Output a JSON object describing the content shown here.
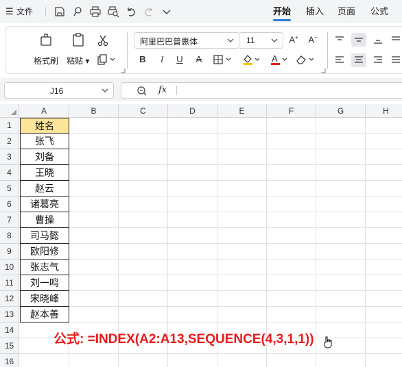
{
  "menu": {
    "file_label": "文件",
    "tabs": [
      "开始",
      "插入",
      "页面",
      "公式"
    ],
    "active_tab": "开始"
  },
  "ribbon": {
    "format_painter": "格式刷",
    "paste": "粘贴",
    "font_name": "阿里巴巴普惠体",
    "font_size": "11"
  },
  "formula_bar": {
    "name_box": "J16",
    "fx": "fx",
    "content": ""
  },
  "sheet": {
    "columns": [
      "A",
      "B",
      "C",
      "D",
      "E",
      "F",
      "G",
      "H"
    ],
    "rows": [
      "1",
      "2",
      "3",
      "4",
      "5",
      "6",
      "7",
      "8",
      "9",
      "10",
      "11",
      "12",
      "13",
      "14",
      "15",
      "16"
    ],
    "header_cell": "姓名",
    "names": [
      "张飞",
      "刘备",
      "王晓",
      "赵云",
      "诸葛亮",
      "曹操",
      "司马懿",
      "欧阳修",
      "张志气",
      "刘一鸣",
      "宋晓峰",
      "赵本善"
    ],
    "annotation": "公式: =INDEX(A2:A13,SEQUENCE(4,3,1,1))"
  },
  "colors": {
    "accent": "#2a7bd9",
    "header_fill": "#fde69a",
    "annotation": "#e81b1b"
  }
}
